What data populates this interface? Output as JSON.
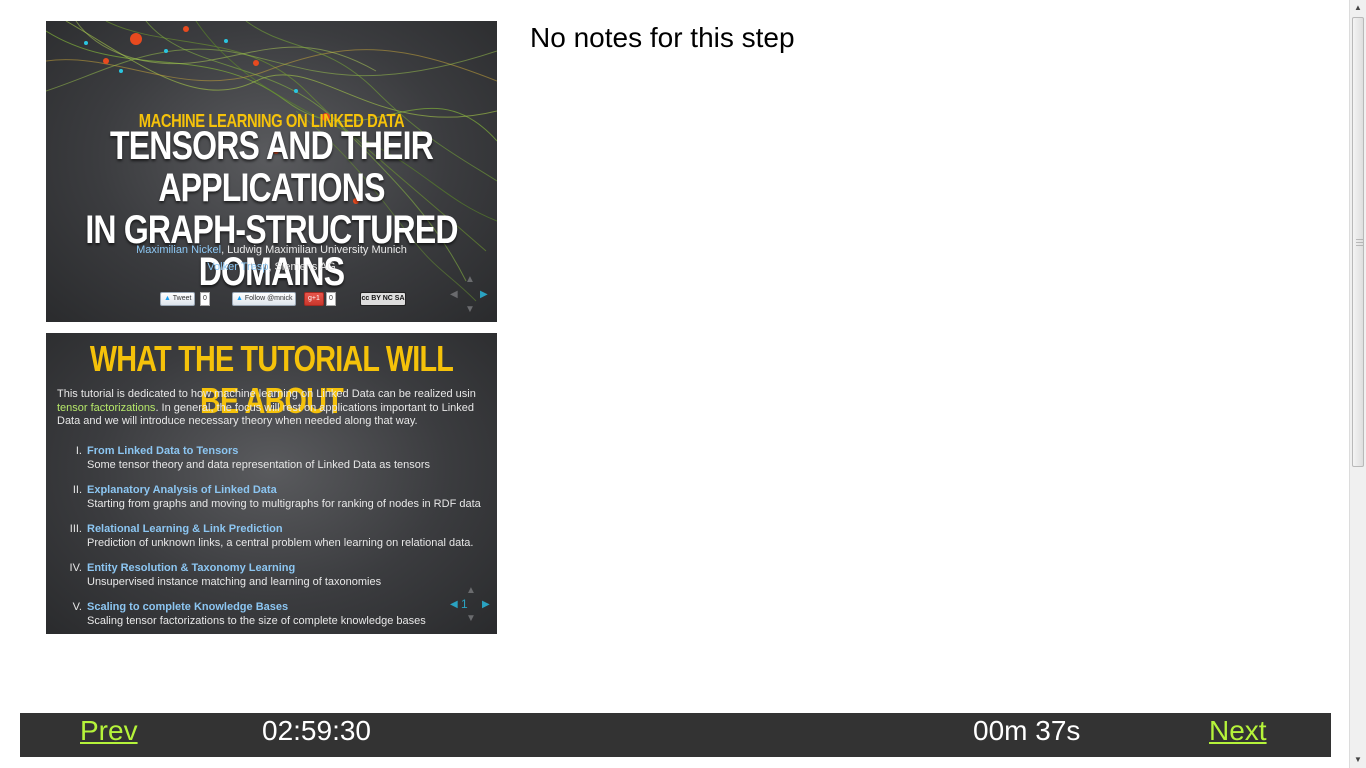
{
  "current_slide": {
    "kicker": "MACHINE LEARNING ON LINKED DATA",
    "title_line1": "TENSORS AND THEIR APPLICATIONS",
    "title_line2": "IN GRAPH-STRUCTURED DOMAINS",
    "author1_name": "Maximilian Nickel",
    "author1_affil": ", Ludwig Maximilian University Munich",
    "author2_name": "Volker Tresp",
    "author2_affil": ", Siemens AG",
    "tweet_label": "Tweet",
    "tweet_count": "0",
    "follow_label": "Follow @mnick",
    "gplus_label": "+1",
    "gplus_count": "0",
    "cc_label": "cc BY NC SA"
  },
  "next_slide": {
    "title": "WHAT THE TUTORIAL WILL BE ABOUT",
    "intro_line1": "This tutorial is dedicated to how machine learning on Linked Data can be realized usin",
    "intro_hl": "tensor factorizations",
    "intro_line2_rest": ". In general, the focus will rest on applications important to Linked",
    "intro_line3": "Data and we will introduce necessary theory when needed along that way.",
    "items": [
      {
        "num": "I.",
        "title": "From Linked Data to Tensors",
        "desc": "Some tensor theory and data representation of Linked Data as tensors"
      },
      {
        "num": "II.",
        "title": "Explanatory Analysis of Linked Data",
        "desc": "Starting from graphs and moving to multigraphs for ranking of nodes in RDF data"
      },
      {
        "num": "III.",
        "title": "Relational Learning & Link Prediction",
        "desc": "Prediction of unknown links, a central problem when learning on relational data."
      },
      {
        "num": "IV.",
        "title": "Entity Resolution & Taxonomy Learning",
        "desc": "Unsupervised instance matching and learning of taxonomies"
      },
      {
        "num": "V.",
        "title": "Scaling to complete Knowledge Bases",
        "desc": "Scaling tensor factorizations to the size of complete knowledge bases"
      }
    ],
    "slide_number": "1"
  },
  "notes": {
    "text": "No notes for this step"
  },
  "bar": {
    "prev_label": "Prev",
    "clock": "02:59:30",
    "elapsed": "00m 37s",
    "next_label": "Next"
  },
  "colors": {
    "bar_bg": "#333333",
    "link_green": "#b5f33a",
    "slide_yellow": "#f5c20a",
    "slide_link_blue": "#8cc6f2"
  }
}
